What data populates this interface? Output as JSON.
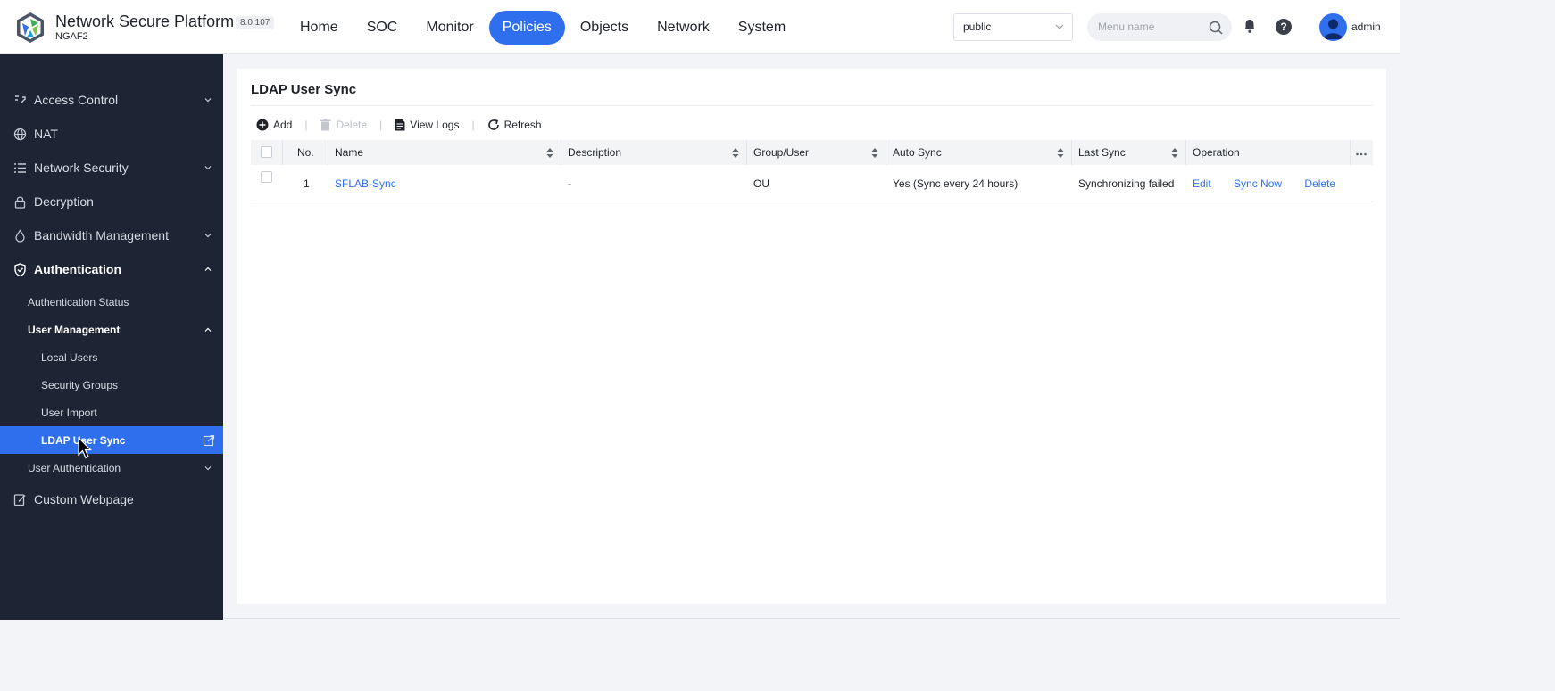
{
  "header": {
    "brand_title": "Network Secure Platform",
    "brand_sub": "NGAF2",
    "version": "8.0.107",
    "nav": [
      "Home",
      "SOC",
      "Monitor",
      "Policies",
      "Objects",
      "Network",
      "System"
    ],
    "active_nav": "Policies",
    "tenant": "public",
    "search_placeholder": "Menu name",
    "help_label": "?",
    "user": "admin"
  },
  "sidebar": {
    "access_control": "Access Control",
    "nat": "NAT",
    "network_security": "Network Security",
    "decryption": "Decryption",
    "bandwidth_management": "Bandwidth Management",
    "authentication": "Authentication",
    "authentication_status": "Authentication Status",
    "user_management": "User Management",
    "local_users": "Local Users",
    "security_groups": "Security Groups",
    "user_import": "User Import",
    "ldap_user_sync": "LDAP User Sync",
    "user_authentication": "User Authentication",
    "custom_webpage": "Custom Webpage"
  },
  "main": {
    "title": "LDAP User Sync",
    "toolbar": {
      "add": "Add",
      "delete": "Delete",
      "view_logs": "View Logs",
      "refresh": "Refresh",
      "separator": "|"
    },
    "columns": {
      "no": "No.",
      "name": "Name",
      "description": "Description",
      "group_user": "Group/User",
      "auto_sync": "Auto Sync",
      "last_sync": "Last Sync",
      "operation": "Operation"
    },
    "rows": [
      {
        "no": "1",
        "name": "SFLAB-Sync",
        "description": "-",
        "group_user": "OU",
        "auto_sync": "Yes (Sync every 24 hours)",
        "last_sync": "Synchronizing failed",
        "ops": [
          "Edit",
          "Sync Now",
          "Delete"
        ]
      }
    ]
  },
  "colors": {
    "accent": "#2f6fed",
    "sidebar_bg": "#1d2434"
  }
}
